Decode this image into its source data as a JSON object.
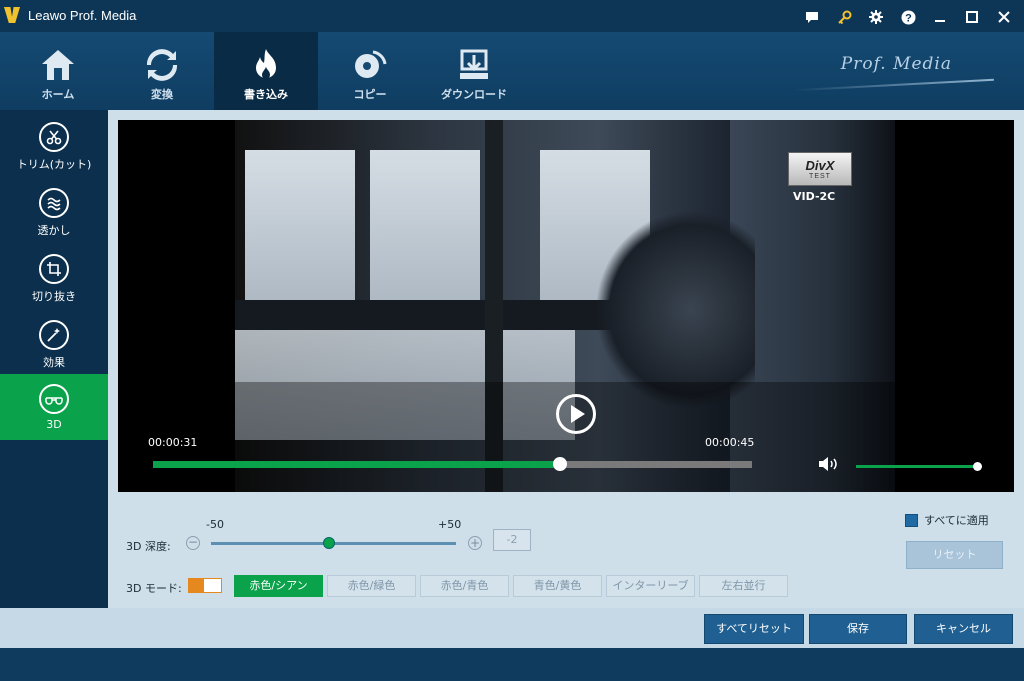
{
  "titlebar": {
    "title": "Leawo Prof. Media"
  },
  "topnav": {
    "tabs": [
      {
        "label": "ホーム",
        "icon": "home-icon"
      },
      {
        "label": "変換",
        "icon": "convert-icon"
      },
      {
        "label": "書き込み",
        "icon": "burn-icon",
        "active": true
      },
      {
        "label": "コピー",
        "icon": "copy-disc-icon"
      },
      {
        "label": "ダウンロード",
        "icon": "download-icon"
      }
    ],
    "brand": "Prof. Media"
  },
  "sidebar": {
    "items": [
      {
        "label": "トリム(カット)",
        "icon": "scissors-icon"
      },
      {
        "label": "透かし",
        "icon": "watermark-icon"
      },
      {
        "label": "切り抜き",
        "icon": "crop-icon"
      },
      {
        "label": "効果",
        "icon": "effect-icon"
      },
      {
        "label": "3D",
        "icon": "3d-glasses-icon",
        "active": true
      }
    ]
  },
  "player": {
    "divx_logo": "DivX",
    "divx_sub": "TEST",
    "vid_label": "VID-2C",
    "time_current": "00:00:31",
    "time_total": "00:00:45",
    "progress": 0.68,
    "volume": 0.99
  },
  "controls": {
    "depth_label": "3D 深度:",
    "depth_min": "-50",
    "depth_max": "+50",
    "depth_value": "-2",
    "mode_label": "3D モード:",
    "modes": [
      {
        "label": "赤色/シアン",
        "active": true
      },
      {
        "label": "赤色/緑色"
      },
      {
        "label": "赤色/青色"
      },
      {
        "label": "青色/黄色"
      },
      {
        "label": "インターリーブ"
      },
      {
        "label": "左右並行"
      }
    ],
    "apply_all": "すべてに適用",
    "reset": "リセット"
  },
  "actions": {
    "reset_all": "すべてリセット",
    "save": "保存",
    "cancel": "キャンセル"
  }
}
